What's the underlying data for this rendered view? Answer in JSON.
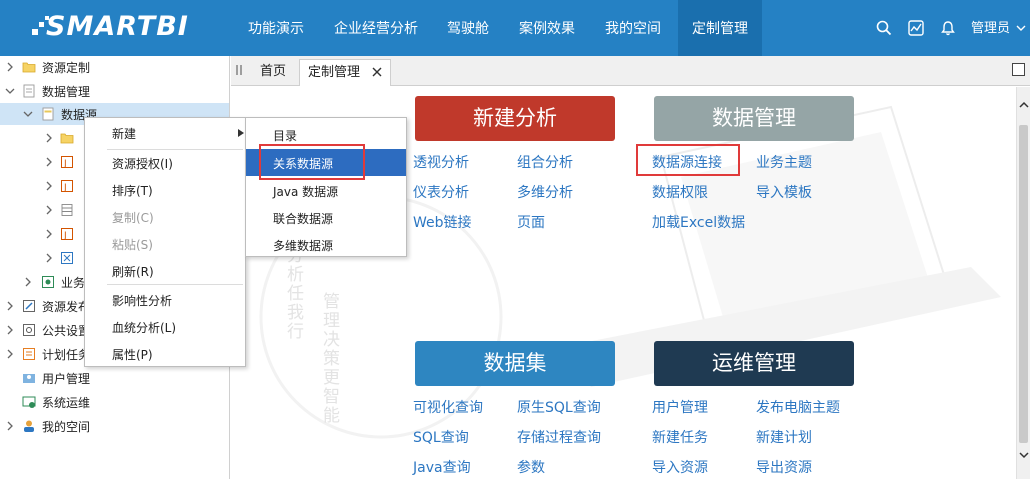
{
  "brand": {
    "logo_text": "SMARTBI"
  },
  "nav": {
    "items": [
      {
        "label": "功能演示",
        "active": false
      },
      {
        "label": "企业经营分析",
        "active": false
      },
      {
        "label": "驾驶舱",
        "active": false
      },
      {
        "label": "案例效果",
        "active": false
      },
      {
        "label": "我的空间",
        "active": false
      },
      {
        "label": "定制管理",
        "active": true
      }
    ],
    "user_label": "管理员"
  },
  "tree": {
    "items": [
      {
        "label": "资源定制",
        "icon": "folder-icon"
      },
      {
        "label": "数据管理",
        "icon": "document-icon"
      },
      {
        "label": "数据源",
        "icon": "document-icon"
      },
      {
        "label": "",
        "icon": "folder-icon"
      },
      {
        "label": "",
        "icon": "java-source-icon"
      },
      {
        "label": "",
        "icon": "java-source-icon"
      },
      {
        "label": "",
        "icon": "database-icon"
      },
      {
        "label": "",
        "icon": "java-source-icon"
      },
      {
        "label": "",
        "icon": "multidim-source-icon"
      },
      {
        "label": "业务",
        "icon": "business-theme-icon"
      },
      {
        "label": "资源发布",
        "icon": "publish-icon"
      },
      {
        "label": "公共设置",
        "icon": "settings-icon"
      },
      {
        "label": "计划任务",
        "icon": "schedule-icon"
      },
      {
        "label": "用户管理",
        "icon": "user-manage-icon"
      },
      {
        "label": "系统运维",
        "icon": "system-ops-icon"
      },
      {
        "label": "我的空间",
        "icon": "my-space-icon"
      }
    ]
  },
  "tabs": {
    "items": [
      {
        "label": "首页"
      },
      {
        "label": "定制管理"
      }
    ]
  },
  "context_menu": {
    "items": [
      {
        "label": "新建",
        "disabled": false
      },
      {
        "label": "资源授权(I)",
        "disabled": false
      },
      {
        "label": "排序(T)",
        "disabled": false
      },
      {
        "label": "复制(C)",
        "disabled": true
      },
      {
        "label": "粘贴(S)",
        "disabled": true
      },
      {
        "label": "刷新(R)",
        "disabled": false
      },
      {
        "label": "影响性分析",
        "disabled": false
      },
      {
        "label": "血统分析(L)",
        "disabled": false
      },
      {
        "label": "属性(P)",
        "disabled": false
      }
    ]
  },
  "sub_menu": {
    "items": [
      {
        "label": "目录"
      },
      {
        "label": "关系数据源"
      },
      {
        "label": "Java 数据源"
      },
      {
        "label": "联合数据源"
      },
      {
        "label": "多维数据源"
      }
    ],
    "selected_index": 1
  },
  "sections": {
    "new_analysis": {
      "title": "新建分析",
      "color": "#c0392b",
      "links": [
        "透视分析",
        "组合分析",
        "仪表分析",
        "多维分析",
        "Web链接",
        "页面"
      ]
    },
    "data_management": {
      "title": "数据管理",
      "color": "#95a5a6",
      "links": [
        "数据源连接",
        "业务主题",
        "数据权限",
        "导入模板",
        "加载Excel数据"
      ]
    },
    "dataset": {
      "title": "数据集",
      "color": "#2e86c1",
      "links": [
        "可视化查询",
        "原生SQL查询",
        "SQL查询",
        "存储过程查询",
        "Java查询",
        "参数"
      ]
    },
    "ops_management": {
      "title": "运维管理",
      "color": "#1f3a52",
      "links": [
        "用户管理",
        "发布电脑主题",
        "新建任务",
        "新建计划",
        "导入资源",
        "导出资源"
      ]
    }
  },
  "background_text": {
    "col1": "能分析任我行",
    "col2": "管理决策更智能"
  },
  "colors": {
    "topbar": "#2581c4",
    "link": "#2d77c2",
    "highlight_box": "#e03a3a",
    "menu_selected": "#2d6cc0"
  }
}
